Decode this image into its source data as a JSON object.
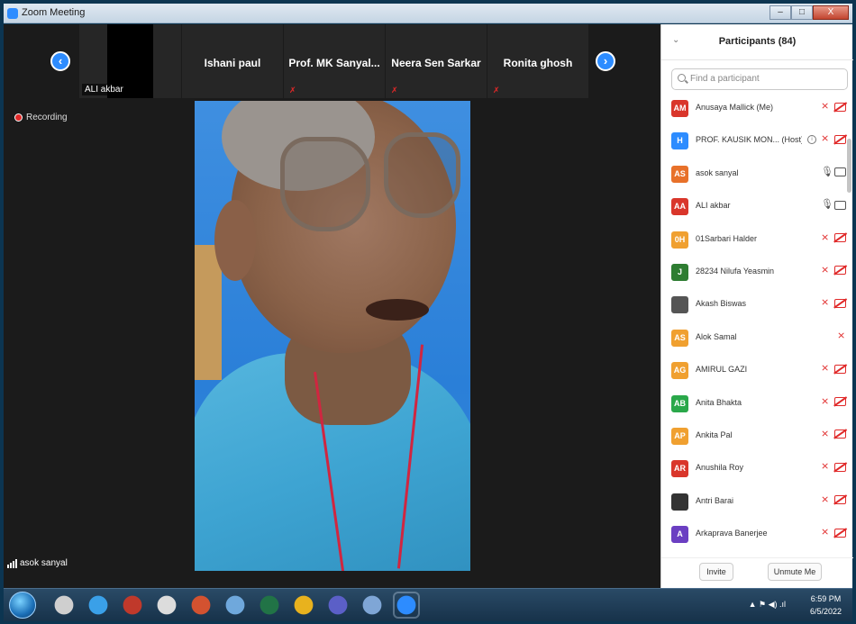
{
  "window": {
    "title": "Zoom Meeting",
    "buttons": {
      "minimize": "–",
      "maximize": "□",
      "close": "X"
    }
  },
  "gallery_strip": {
    "tiles": [
      {
        "name": "ALI akbar"
      },
      {
        "name": "Ishani paul"
      },
      {
        "name": "Prof. MK Sanyal..."
      },
      {
        "name": "Neera Sen Sarkar"
      },
      {
        "name": "Ronita ghosh"
      }
    ]
  },
  "recording": {
    "label": "Recording"
  },
  "active_speaker": {
    "name": "asok sanyal"
  },
  "participants": {
    "title": "Participants (84)",
    "search_placeholder": "Find a participant",
    "list": [
      {
        "initials": "AM",
        "color": "#d9362b",
        "name": "Anusaya Mallick (Me)",
        "mic": "off",
        "cam": "off"
      },
      {
        "initials": "H",
        "color": "#2d8cff",
        "name": "PROF. KAUSIK MON... (Host)",
        "mic": "off",
        "cam": "off",
        "host": true
      },
      {
        "initials": "AS",
        "color": "#e8712a",
        "name": "asok sanyal",
        "mic": "on",
        "cam": "on"
      },
      {
        "initials": "AA",
        "color": "#d9362b",
        "name": "ALI akbar",
        "mic": "on",
        "cam": "on"
      },
      {
        "initials": "0H",
        "color": "#f0a030",
        "name": "01Sarbari Halder",
        "mic": "off",
        "cam": "off"
      },
      {
        "initials": "J",
        "color": "#2e7d32",
        "name": "28234 Nilufa Yeasmin",
        "mic": "off",
        "cam": "off"
      },
      {
        "initials": "",
        "color": "#555555",
        "name": "Akash Biswas",
        "mic": "off",
        "cam": "off",
        "photo": true
      },
      {
        "initials": "AS",
        "color": "#f0a030",
        "name": "Alok Samal",
        "mic": "off",
        "cam": "none"
      },
      {
        "initials": "AG",
        "color": "#f0a030",
        "name": "AMIRUL GAZI",
        "mic": "off",
        "cam": "off"
      },
      {
        "initials": "AB",
        "color": "#2aa84a",
        "name": "Anita Bhakta",
        "mic": "off",
        "cam": "off"
      },
      {
        "initials": "AP",
        "color": "#f0a030",
        "name": "Ankita Pal",
        "mic": "off",
        "cam": "off"
      },
      {
        "initials": "AR",
        "color": "#d9362b",
        "name": "Anushila Roy",
        "mic": "off",
        "cam": "off"
      },
      {
        "initials": "",
        "color": "#333333",
        "name": "Antri Barai",
        "mic": "off",
        "cam": "off",
        "photo": true
      },
      {
        "initials": "A",
        "color": "#6b3fc2",
        "name": "Arkaprava Banerjee",
        "mic": "off",
        "cam": "off"
      }
    ],
    "footer": {
      "invite": "Invite",
      "unmute": "Unmute Me"
    }
  },
  "taskbar": {
    "icons": [
      {
        "name": "windows-start-icon"
      },
      {
        "name": "shield-app-icon",
        "color": "#cfcfcf"
      },
      {
        "name": "internet-explorer-icon",
        "color": "#3aa0e8"
      },
      {
        "name": "media-app-icon",
        "color": "#c0392b"
      },
      {
        "name": "paint-icon",
        "color": "#dcdcdc"
      },
      {
        "name": "powerpoint-icon",
        "color": "#d35230"
      },
      {
        "name": "network-app-icon",
        "color": "#6fa8dc"
      },
      {
        "name": "excel-icon",
        "color": "#217346"
      },
      {
        "name": "chrome-icon",
        "color": "#e8b21e"
      },
      {
        "name": "teams-icon",
        "color": "#5b5fc7"
      },
      {
        "name": "notepad-icon",
        "color": "#7fa6d6"
      },
      {
        "name": "zoom-icon",
        "color": "#2d8cff"
      }
    ],
    "clock": {
      "time": "6:59 PM",
      "date": "6/5/2022"
    }
  }
}
